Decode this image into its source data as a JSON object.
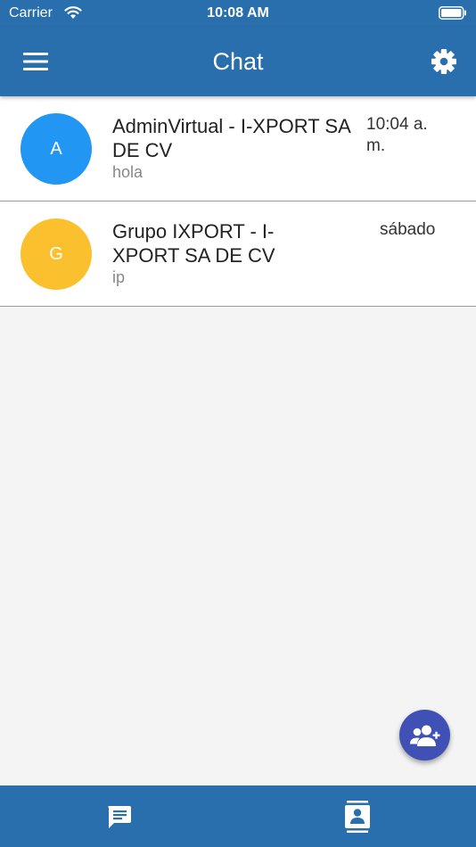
{
  "status_bar": {
    "carrier": "Carrier",
    "time": "10:08 AM",
    "icons": [
      "wifi-icon",
      "battery-icon"
    ]
  },
  "app_bar": {
    "title": "Chat",
    "menu_icon": "menu-icon",
    "settings_icon": "settings-gear-icon"
  },
  "chats": [
    {
      "initial": "A",
      "name": "AdminVirtual - I-XPORT SA DE CV",
      "preview": "hola",
      "time": "10:04 a. m.",
      "avatar_color": "#2196f3"
    },
    {
      "initial": "G",
      "name": "Grupo IXPORT - I-XPORT SA DE CV",
      "preview": "ip",
      "time": "sábado",
      "avatar_color": "#fbc02d"
    }
  ],
  "fab": {
    "icon": "add-contact-icon"
  },
  "bottom_nav": {
    "tabs": [
      {
        "icon": "chat-icon"
      },
      {
        "icon": "contacts-icon"
      }
    ]
  },
  "colors": {
    "primary": "#2a6fad",
    "fab": "#3f51b5",
    "background": "#f4f4f4"
  }
}
